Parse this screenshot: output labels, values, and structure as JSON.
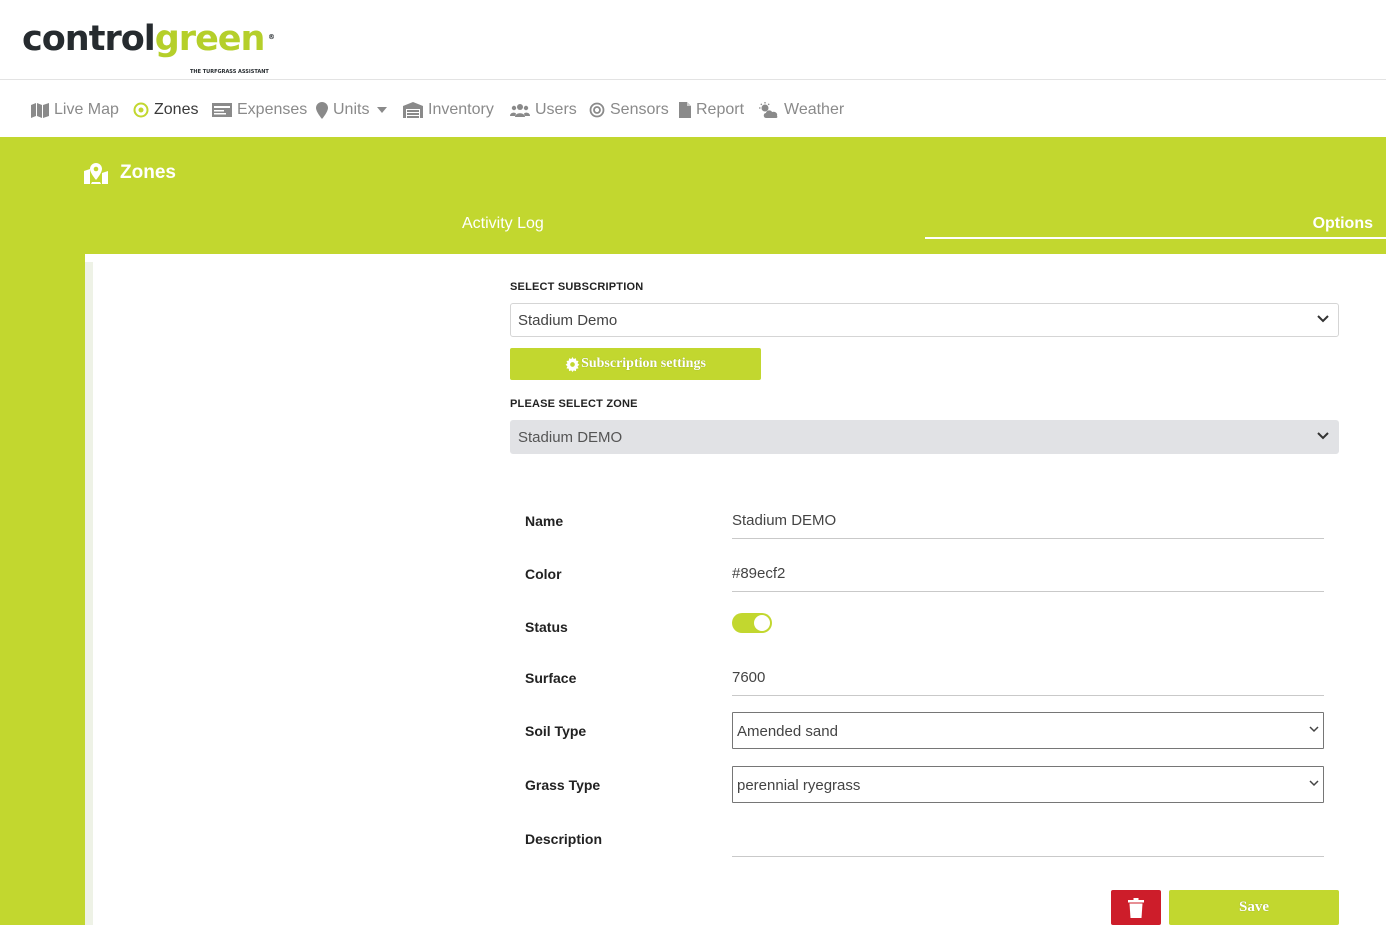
{
  "logo": {
    "dark": "control",
    "green": "green",
    "registered": "®",
    "tagline": "THE TURFGRASS ASSISTANT"
  },
  "nav": {
    "items": [
      {
        "label": "Live Map",
        "icon": "map-icon"
      },
      {
        "label": "Zones",
        "icon": "target-icon",
        "active": true
      },
      {
        "label": "Expenses",
        "icon": "money-icon"
      },
      {
        "label": "Units",
        "icon": "map-pin-icon",
        "dropdown": true
      },
      {
        "label": "Inventory",
        "icon": "warehouse-icon"
      },
      {
        "label": "Users",
        "icon": "users-icon"
      },
      {
        "label": "Sensors",
        "icon": "sensor-icon"
      },
      {
        "label": "Report",
        "icon": "document-icon"
      },
      {
        "label": "Weather",
        "icon": "cloud-sun-icon"
      }
    ]
  },
  "page": {
    "title": "Zones",
    "tabs": {
      "activity_log": "Activity Log",
      "options": "Options"
    }
  },
  "form": {
    "subscription_label": "SELECT SUBSCRIPTION",
    "subscription_value": "Stadium Demo",
    "subscription_settings_label": "Subscription settings",
    "zone_label": "PLEASE SELECT ZONE",
    "zone_value": "Stadium DEMO",
    "fields": {
      "name_label": "Name",
      "name_value": "Stadium DEMO",
      "color_label": "Color",
      "color_value": "#89ecf2",
      "status_label": "Status",
      "status_on": true,
      "surface_label": "Surface",
      "surface_value": "7600",
      "soil_label": "Soil Type",
      "soil_value": "Amended sand",
      "grass_label": "Grass Type",
      "grass_value": "perennial ryegrass",
      "description_label": "Description",
      "description_value": ""
    },
    "save_label": "Save"
  },
  "colors": {
    "brand_green": "#c2d72f",
    "danger": "#cd1d2a",
    "dark": "#262b2f"
  }
}
